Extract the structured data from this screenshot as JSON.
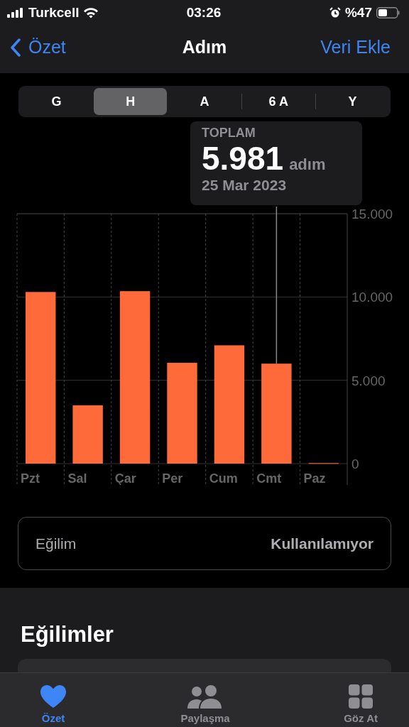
{
  "status_bar": {
    "carrier": "Turkcell",
    "time": "03:26",
    "battery": "%47"
  },
  "nav": {
    "back": "Özet",
    "title": "Adım",
    "action": "Veri Ekle"
  },
  "segments": [
    {
      "label": "G",
      "selected": false
    },
    {
      "label": "H",
      "selected": true
    },
    {
      "label": "A",
      "selected": false
    },
    {
      "label": "6 A",
      "selected": false
    },
    {
      "label": "Y",
      "selected": false
    }
  ],
  "tooltip": {
    "heading": "TOPLAM",
    "value": "5.981",
    "unit": "adım",
    "date": "25 Mar 2023"
  },
  "chart_data": {
    "type": "bar",
    "categories": [
      "Pzt",
      "Sal",
      "Çar",
      "Per",
      "Cum",
      "Cmt",
      "Paz"
    ],
    "series": [
      {
        "color": "#ff6a3a",
        "values": [
          10300,
          3500,
          10350,
          6050,
          7100,
          6000,
          30
        ]
      }
    ],
    "ylim": [
      0,
      15000
    ],
    "yticks": [
      {
        "value": 0,
        "label": "0"
      },
      {
        "value": 5000,
        "label": "5.000"
      },
      {
        "value": 10000,
        "label": "10.000"
      },
      {
        "value": 15000,
        "label": "15.000"
      }
    ]
  },
  "trend_row": {
    "label": "Eğilim",
    "value": "Kullanılamıyor"
  },
  "section_title": "Eğilimler",
  "tab_bar": [
    {
      "label": "Özet",
      "selected": true
    },
    {
      "label": "Paylaşma",
      "selected": false
    },
    {
      "label": "Göz At",
      "selected": false
    }
  ]
}
